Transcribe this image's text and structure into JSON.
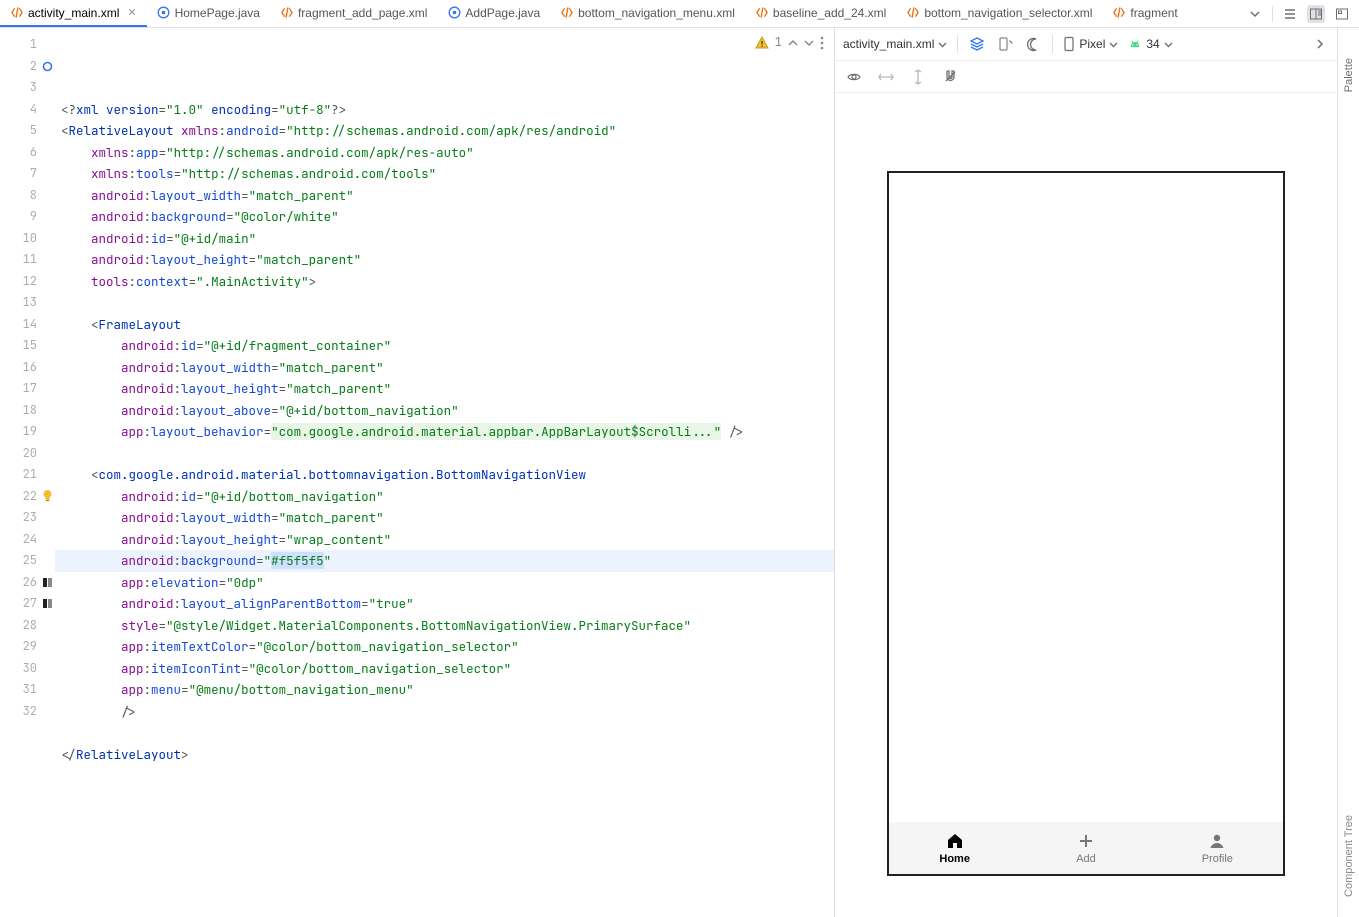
{
  "tabs": [
    {
      "label": "activity_main.xml",
      "icon": "xml",
      "active": true,
      "closeable": true
    },
    {
      "label": "HomePage.java",
      "icon": "java"
    },
    {
      "label": "fragment_add_page.xml",
      "icon": "xml"
    },
    {
      "label": "AddPage.java",
      "icon": "java"
    },
    {
      "label": "bottom_navigation_menu.xml",
      "icon": "xml"
    },
    {
      "label": "baseline_add_24.xml",
      "icon": "xml"
    },
    {
      "label": "bottom_navigation_selector.xml",
      "icon": "xml"
    },
    {
      "label": "fragment",
      "icon": "xml",
      "truncated": true
    }
  ],
  "inspections": {
    "warnings": "1"
  },
  "gutter": {
    "total_lines": 32,
    "icons": {
      "2": "ring-blue",
      "22": "bulb",
      "26": "swatch",
      "27": "swatch"
    }
  },
  "code_lines": [
    {
      "n": 1,
      "seg": [
        {
          "t": "<?",
          "c": "punc"
        },
        {
          "t": "xml version",
          "c": "tag"
        },
        {
          "t": "=",
          "c": "punc"
        },
        {
          "t": "\"1.0\"",
          "c": "str"
        },
        {
          "t": " encoding",
          "c": "tag"
        },
        {
          "t": "=",
          "c": "punc"
        },
        {
          "t": "\"utf-8\"",
          "c": "str"
        },
        {
          "t": "?>",
          "c": "punc"
        }
      ]
    },
    {
      "n": 2,
      "seg": [
        {
          "t": "<",
          "c": "punc"
        },
        {
          "t": "RelativeLayout ",
          "c": "tag"
        },
        {
          "t": "xmlns",
          "c": "attr"
        },
        {
          "t": ":",
          "c": "punc"
        },
        {
          "t": "android",
          "c": "attr2"
        },
        {
          "t": "=",
          "c": "punc"
        },
        {
          "t": "\"http://schemas.android.com/apk/res/android\"",
          "c": "str"
        }
      ]
    },
    {
      "n": 3,
      "indent": 4,
      "seg": [
        {
          "t": "xmlns",
          "c": "attr"
        },
        {
          "t": ":",
          "c": "punc"
        },
        {
          "t": "app",
          "c": "attr2"
        },
        {
          "t": "=",
          "c": "punc"
        },
        {
          "t": "\"http://schemas.android.com/apk/res-auto\"",
          "c": "str"
        }
      ]
    },
    {
      "n": 4,
      "indent": 4,
      "seg": [
        {
          "t": "xmlns",
          "c": "attr"
        },
        {
          "t": ":",
          "c": "punc"
        },
        {
          "t": "tools",
          "c": "attr2"
        },
        {
          "t": "=",
          "c": "punc"
        },
        {
          "t": "\"http://schemas.android.com/tools\"",
          "c": "str"
        }
      ]
    },
    {
      "n": 5,
      "indent": 4,
      "seg": [
        {
          "t": "android",
          "c": "attr"
        },
        {
          "t": ":",
          "c": "punc"
        },
        {
          "t": "layout_width",
          "c": "attr2"
        },
        {
          "t": "=",
          "c": "punc"
        },
        {
          "t": "\"match_parent\"",
          "c": "str"
        }
      ]
    },
    {
      "n": 6,
      "indent": 4,
      "seg": [
        {
          "t": "android",
          "c": "attr"
        },
        {
          "t": ":",
          "c": "punc"
        },
        {
          "t": "background",
          "c": "attr2"
        },
        {
          "t": "=",
          "c": "punc"
        },
        {
          "t": "\"@color/white\"",
          "c": "str"
        }
      ]
    },
    {
      "n": 7,
      "indent": 4,
      "seg": [
        {
          "t": "android",
          "c": "attr"
        },
        {
          "t": ":",
          "c": "punc"
        },
        {
          "t": "id",
          "c": "attr2"
        },
        {
          "t": "=",
          "c": "punc"
        },
        {
          "t": "\"@+id/main\"",
          "c": "str"
        }
      ]
    },
    {
      "n": 8,
      "indent": 4,
      "seg": [
        {
          "t": "android",
          "c": "attr"
        },
        {
          "t": ":",
          "c": "punc"
        },
        {
          "t": "layout_height",
          "c": "attr2"
        },
        {
          "t": "=",
          "c": "punc"
        },
        {
          "t": "\"match_parent\"",
          "c": "str"
        }
      ]
    },
    {
      "n": 9,
      "indent": 4,
      "seg": [
        {
          "t": "tools",
          "c": "attr"
        },
        {
          "t": ":",
          "c": "punc"
        },
        {
          "t": "context",
          "c": "attr2"
        },
        {
          "t": "=",
          "c": "punc"
        },
        {
          "t": "\".MainActivity\"",
          "c": "str"
        },
        {
          "t": ">",
          "c": "punc"
        }
      ]
    },
    {
      "n": 10,
      "seg": []
    },
    {
      "n": 11,
      "indent": 4,
      "seg": [
        {
          "t": "<",
          "c": "punc"
        },
        {
          "t": "FrameLayout",
          "c": "tag"
        }
      ]
    },
    {
      "n": 12,
      "indent": 8,
      "seg": [
        {
          "t": "android",
          "c": "attr"
        },
        {
          "t": ":",
          "c": "punc"
        },
        {
          "t": "id",
          "c": "attr2"
        },
        {
          "t": "=",
          "c": "punc"
        },
        {
          "t": "\"@+id/fragment_container\"",
          "c": "str"
        }
      ]
    },
    {
      "n": 13,
      "indent": 8,
      "seg": [
        {
          "t": "android",
          "c": "attr"
        },
        {
          "t": ":",
          "c": "punc"
        },
        {
          "t": "layout_width",
          "c": "attr2"
        },
        {
          "t": "=",
          "c": "punc"
        },
        {
          "t": "\"match_parent\"",
          "c": "str"
        }
      ]
    },
    {
      "n": 14,
      "indent": 8,
      "seg": [
        {
          "t": "android",
          "c": "attr"
        },
        {
          "t": ":",
          "c": "punc"
        },
        {
          "t": "layout_height",
          "c": "attr2"
        },
        {
          "t": "=",
          "c": "punc"
        },
        {
          "t": "\"match_parent\"",
          "c": "str"
        }
      ]
    },
    {
      "n": 15,
      "indent": 8,
      "seg": [
        {
          "t": "android",
          "c": "attr"
        },
        {
          "t": ":",
          "c": "punc"
        },
        {
          "t": "layout_above",
          "c": "attr2"
        },
        {
          "t": "=",
          "c": "punc"
        },
        {
          "t": "\"@+id/bottom_navigation\"",
          "c": "str"
        }
      ]
    },
    {
      "n": 16,
      "indent": 8,
      "seg": [
        {
          "t": "app",
          "c": "attr"
        },
        {
          "t": ":",
          "c": "punc"
        },
        {
          "t": "layout_behavior",
          "c": "attr2"
        },
        {
          "t": "=",
          "c": "punc"
        },
        {
          "t": "\"com.google.android.material.appbar.AppBarLayout$Scrolli...\"",
          "c": "str",
          "bg": true
        },
        {
          "t": " />",
          "c": "punc"
        }
      ]
    },
    {
      "n": 17,
      "seg": []
    },
    {
      "n": 18,
      "indent": 4,
      "seg": [
        {
          "t": "<",
          "c": "punc"
        },
        {
          "t": "com.google.android.material.bottomnavigation.BottomNavigationView",
          "c": "tag"
        }
      ]
    },
    {
      "n": 19,
      "indent": 8,
      "seg": [
        {
          "t": "android",
          "c": "attr"
        },
        {
          "t": ":",
          "c": "punc"
        },
        {
          "t": "id",
          "c": "attr2"
        },
        {
          "t": "=",
          "c": "punc"
        },
        {
          "t": "\"@+id/bottom_navigation\"",
          "c": "str"
        }
      ]
    },
    {
      "n": 20,
      "indent": 8,
      "seg": [
        {
          "t": "android",
          "c": "attr"
        },
        {
          "t": ":",
          "c": "punc"
        },
        {
          "t": "layout_width",
          "c": "attr2"
        },
        {
          "t": "=",
          "c": "punc"
        },
        {
          "t": "\"match_parent\"",
          "c": "str"
        }
      ]
    },
    {
      "n": 21,
      "indent": 8,
      "seg": [
        {
          "t": "android",
          "c": "attr"
        },
        {
          "t": ":",
          "c": "punc"
        },
        {
          "t": "layout_height",
          "c": "attr2"
        },
        {
          "t": "=",
          "c": "punc"
        },
        {
          "t": "\"wrap_content\"",
          "c": "str"
        }
      ]
    },
    {
      "n": 22,
      "indent": 8,
      "hl": true,
      "seg": [
        {
          "t": "android",
          "c": "attr"
        },
        {
          "t": ":",
          "c": "punc"
        },
        {
          "t": "background",
          "c": "attr2"
        },
        {
          "t": "=",
          "c": "punc"
        },
        {
          "t": "\"",
          "c": "str"
        },
        {
          "t": "#f5f5f5",
          "c": "str",
          "sel": true
        },
        {
          "t": "\"",
          "c": "str"
        }
      ]
    },
    {
      "n": 23,
      "indent": 8,
      "seg": [
        {
          "t": "app",
          "c": "attr"
        },
        {
          "t": ":",
          "c": "punc"
        },
        {
          "t": "elevation",
          "c": "attr2"
        },
        {
          "t": "=",
          "c": "punc"
        },
        {
          "t": "\"0dp\"",
          "c": "str"
        }
      ]
    },
    {
      "n": 24,
      "indent": 8,
      "seg": [
        {
          "t": "android",
          "c": "attr"
        },
        {
          "t": ":",
          "c": "punc"
        },
        {
          "t": "layout_alignParentBottom",
          "c": "attr2"
        },
        {
          "t": "=",
          "c": "punc"
        },
        {
          "t": "\"true\"",
          "c": "str"
        }
      ]
    },
    {
      "n": 25,
      "indent": 8,
      "seg": [
        {
          "t": "style",
          "c": "attr"
        },
        {
          "t": "=",
          "c": "punc"
        },
        {
          "t": "\"@style/Widget.MaterialComponents.BottomNavigationView.PrimarySurface\"",
          "c": "str"
        }
      ]
    },
    {
      "n": 26,
      "indent": 8,
      "seg": [
        {
          "t": "app",
          "c": "attr"
        },
        {
          "t": ":",
          "c": "punc"
        },
        {
          "t": "itemTextColor",
          "c": "attr2"
        },
        {
          "t": "=",
          "c": "punc"
        },
        {
          "t": "\"@color/bottom_navigation_selector\"",
          "c": "str"
        }
      ]
    },
    {
      "n": 27,
      "indent": 8,
      "seg": [
        {
          "t": "app",
          "c": "attr"
        },
        {
          "t": ":",
          "c": "punc"
        },
        {
          "t": "itemIconTint",
          "c": "attr2"
        },
        {
          "t": "=",
          "c": "punc"
        },
        {
          "t": "\"@color/bottom_navigation_selector\"",
          "c": "str"
        }
      ]
    },
    {
      "n": 28,
      "indent": 8,
      "seg": [
        {
          "t": "app",
          "c": "attr"
        },
        {
          "t": ":",
          "c": "punc"
        },
        {
          "t": "menu",
          "c": "attr2"
        },
        {
          "t": "=",
          "c": "punc"
        },
        {
          "t": "\"@menu/bottom_navigation_menu\"",
          "c": "str"
        }
      ]
    },
    {
      "n": 29,
      "indent": 8,
      "seg": [
        {
          "t": "/>",
          "c": "punc"
        }
      ]
    },
    {
      "n": 30,
      "seg": []
    },
    {
      "n": 31,
      "seg": [
        {
          "t": "</",
          "c": "punc"
        },
        {
          "t": "RelativeLayout",
          "c": "tag"
        },
        {
          "t": ">",
          "c": "punc"
        }
      ]
    },
    {
      "n": 32,
      "seg": []
    }
  ],
  "design": {
    "file_selector": "activity_main.xml",
    "device": "Pixel",
    "api": "34",
    "sidetabs": [
      "Palette",
      "Component Tree"
    ],
    "bottom_nav": [
      {
        "label": "Home",
        "icon": "home",
        "active": true
      },
      {
        "label": "Add",
        "icon": "plus"
      },
      {
        "label": "Profile",
        "icon": "person"
      }
    ]
  }
}
